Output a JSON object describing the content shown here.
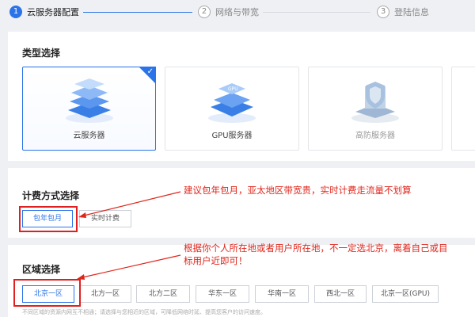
{
  "steps": [
    {
      "num": "1",
      "label": "云服务器配置"
    },
    {
      "num": "2",
      "label": "网络与带宽"
    },
    {
      "num": "3",
      "label": "登陆信息"
    }
  ],
  "type_section": {
    "title": "类型选择",
    "cards": [
      {
        "label": "云服务器",
        "icon": "cloud-server-icon",
        "selected": true
      },
      {
        "label": "GPU服务器",
        "icon": "gpu-chip-icon",
        "chip_text": "GPU",
        "selected": false
      },
      {
        "label": "高防服务器",
        "icon": "shield-server-icon",
        "selected": false
      }
    ]
  },
  "billing_section": {
    "title": "计费方式选择",
    "options": [
      "包年包月",
      "实时计费"
    ],
    "selected": "包年包月"
  },
  "region_section": {
    "title": "区域选择",
    "options": [
      "北京一区",
      "北方一区",
      "北方二区",
      "华东一区",
      "华南一区",
      "西北一区",
      "北京一区(GPU)"
    ],
    "selected": "北京一区",
    "hint": "不同区域的资源内网互不相通；请选择与您相近的区域，可降低网络时延、提高您客户的访问速度。"
  },
  "annotations": {
    "billing_note": "建议包年包月，亚太地区带宽贵，实时计费走流量不划算",
    "region_note_line1": "根据你个人所在地或者用户所在地，不一定选北京，离着自己或目",
    "region_note_line2": "标用户近即可！"
  },
  "colors": {
    "accent": "#2a73e8",
    "annotation_red": "#e0251b"
  }
}
